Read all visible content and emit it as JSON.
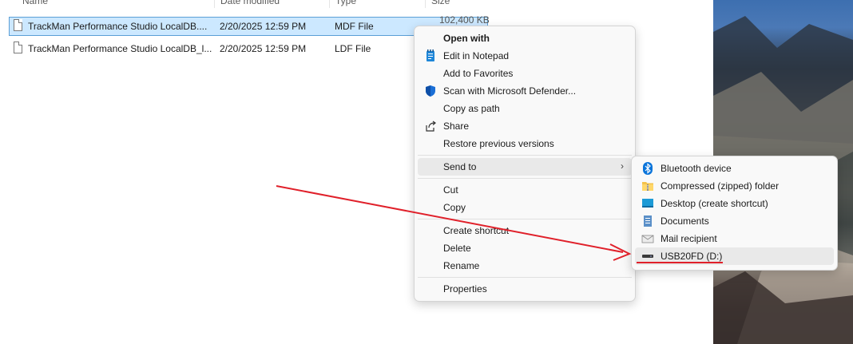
{
  "columns": {
    "name": "Name",
    "date": "Date modified",
    "type": "Type",
    "size": "Size"
  },
  "files": [
    {
      "name": "TrackMan Performance Studio LocalDB....",
      "date": "2/20/2025 12:59 PM",
      "type": "MDF File",
      "size": "102,400 KB"
    },
    {
      "name": "TrackMan Performance Studio LocalDB_l...",
      "date": "2/20/2025 12:59 PM",
      "type": "LDF File",
      "size": ""
    }
  ],
  "context_menu": {
    "open_with": "Open with",
    "edit_notepad": "Edit in Notepad",
    "add_favorites": "Add to Favorites",
    "scan_defender": "Scan with Microsoft Defender...",
    "copy_path": "Copy as path",
    "share": "Share",
    "restore": "Restore previous versions",
    "send_to": "Send to",
    "cut": "Cut",
    "copy": "Copy",
    "create_shortcut": "Create shortcut",
    "delete": "Delete",
    "rename": "Rename",
    "properties": "Properties"
  },
  "send_to_menu": {
    "bluetooth": "Bluetooth device",
    "compressed": "Compressed (zipped) folder",
    "desktop": "Desktop (create shortcut)",
    "documents": "Documents",
    "mail": "Mail recipient",
    "usb": "USB20FD (D:)"
  },
  "colors": {
    "annotation": "#e0202a",
    "selection": "#cce8ff",
    "defender": "#1a6fd6",
    "bluetooth": "#0a74da"
  }
}
